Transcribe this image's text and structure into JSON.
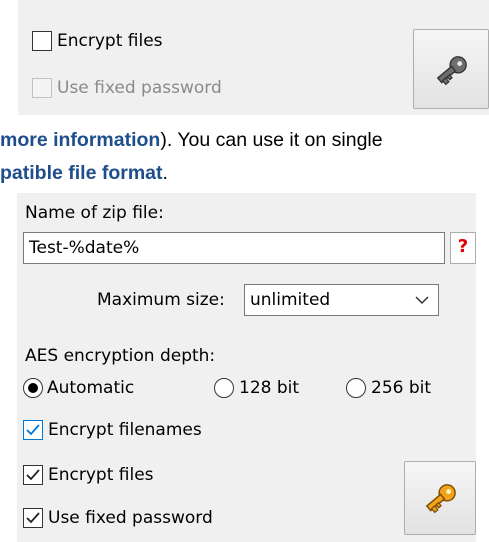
{
  "top_panel": {
    "encrypt_files_label": "Encrypt files",
    "encrypt_files_checked": false,
    "use_fixed_password_label": "Use fixed password",
    "use_fixed_password_enabled": false,
    "key_button_icon": "key-icon-gray"
  },
  "doc_text": {
    "line1_link": "more information",
    "line1_rest": "). You can use it on single",
    "line2_link": "patible file format",
    "line2_end": "."
  },
  "zip_panel": {
    "name_label": "Name of zip file:",
    "name_value": "Test-%date%",
    "help_button_label": "?",
    "max_size_label": "Maximum size:",
    "max_size_value": "unlimited",
    "aes_label": "AES encryption depth:",
    "radio_options": [
      {
        "label": "Automatic",
        "selected": true
      },
      {
        "label": "128 bit",
        "selected": false
      },
      {
        "label": "256 bit",
        "selected": false
      }
    ],
    "encrypt_filenames_label": "Encrypt filenames",
    "encrypt_filenames_checked": true,
    "encrypt_files_label": "Encrypt files",
    "encrypt_files_checked": true,
    "use_fixed_password_label": "Use fixed password",
    "use_fixed_password_checked": true,
    "key_button_icon": "key-icon-gold"
  },
  "colors": {
    "link": "#1f4e8c",
    "panel_bg": "#f0f0f0",
    "focus_blue": "#0078d7",
    "help_red": "#e00000",
    "key_gold": "#f2a31b"
  }
}
